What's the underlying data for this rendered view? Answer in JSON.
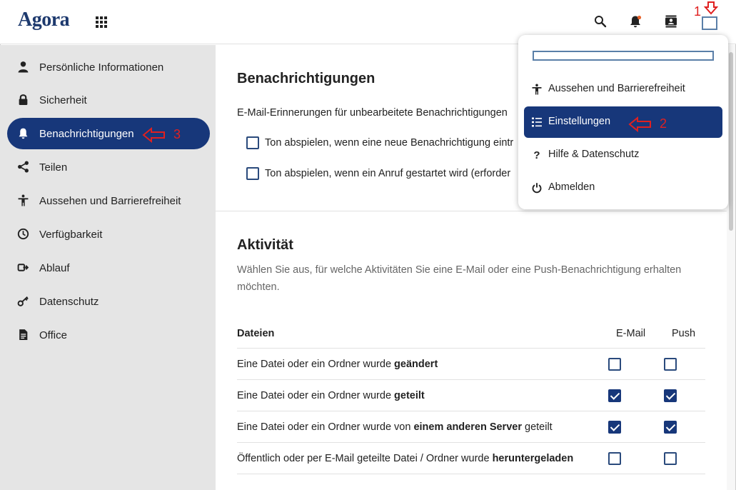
{
  "header": {
    "logo": "Agora",
    "icons": [
      "apps-icon",
      "search-icon",
      "bell-icon",
      "contacts-icon",
      "avatar"
    ]
  },
  "annotations": {
    "marker1": "1",
    "marker2": "2",
    "marker3": "3",
    "color": "#e02020"
  },
  "sidebar": {
    "items": [
      {
        "label": "Persönliche Informationen",
        "icon": "person-icon"
      },
      {
        "label": "Sicherheit",
        "icon": "lock-icon"
      },
      {
        "label": "Benachrichtigungen",
        "icon": "bell-icon",
        "active": true
      },
      {
        "label": "Teilen",
        "icon": "share-icon"
      },
      {
        "label": "Aussehen und Barrierefreiheit",
        "icon": "accessibility-icon"
      },
      {
        "label": "Verfügbarkeit",
        "icon": "clock-icon"
      },
      {
        "label": "Ablauf",
        "icon": "flow-icon"
      },
      {
        "label": "Datenschutz",
        "icon": "key-icon"
      },
      {
        "label": "Office",
        "icon": "document-icon"
      }
    ]
  },
  "notifications": {
    "title": "Benachrichtigungen",
    "reminder_text": "E-Mail-Erinnerungen für unbearbeitete Benachrichtigungen",
    "option_sound_notification": "Ton abspielen, wenn eine neue Benachrichtigung eintr",
    "option_sound_call": "Ton abspielen, wenn ein Anruf gestartet wird (erforder"
  },
  "activity": {
    "title": "Aktivität",
    "description_line1": "Wählen Sie aus, für welche Aktivitäten Sie eine E-Mail oder eine Push-Benachrichtigung erhalten",
    "description_line2": "möchten.",
    "table": {
      "header_name": "Dateien",
      "header_email": "E-Mail",
      "header_push": "Push",
      "rows": [
        {
          "pre": "Eine Datei oder ein Ordner wurde ",
          "bold": "geändert",
          "post": "",
          "email": false,
          "push": false
        },
        {
          "pre": "Eine Datei oder ein Ordner wurde ",
          "bold": "geteilt",
          "post": "",
          "email": true,
          "push": true
        },
        {
          "pre": "Eine Datei oder ein Ordner wurde von ",
          "bold": "einem anderen Server",
          "post": " geteilt",
          "email": true,
          "push": true
        },
        {
          "pre": "Öffentlich oder per E-Mail geteilte Datei / Ordner wurde ",
          "bold": "heruntergeladen",
          "post": "",
          "email": false,
          "push": false
        }
      ]
    }
  },
  "dropdown": {
    "items": [
      {
        "label": "Aussehen und Barrierefreiheit",
        "icon": "accessibility-icon"
      },
      {
        "label": "Einstellungen",
        "icon": "settings-list-icon",
        "active": true
      },
      {
        "label": "Hilfe & Datenschutz",
        "icon": "help-icon"
      },
      {
        "label": "Abmelden",
        "icon": "power-icon"
      }
    ]
  },
  "colors": {
    "primary": "#17377a",
    "sidebar_bg": "#e5e5e5",
    "logo": "#1e3a6e",
    "notification_dot": "#e8632b"
  }
}
